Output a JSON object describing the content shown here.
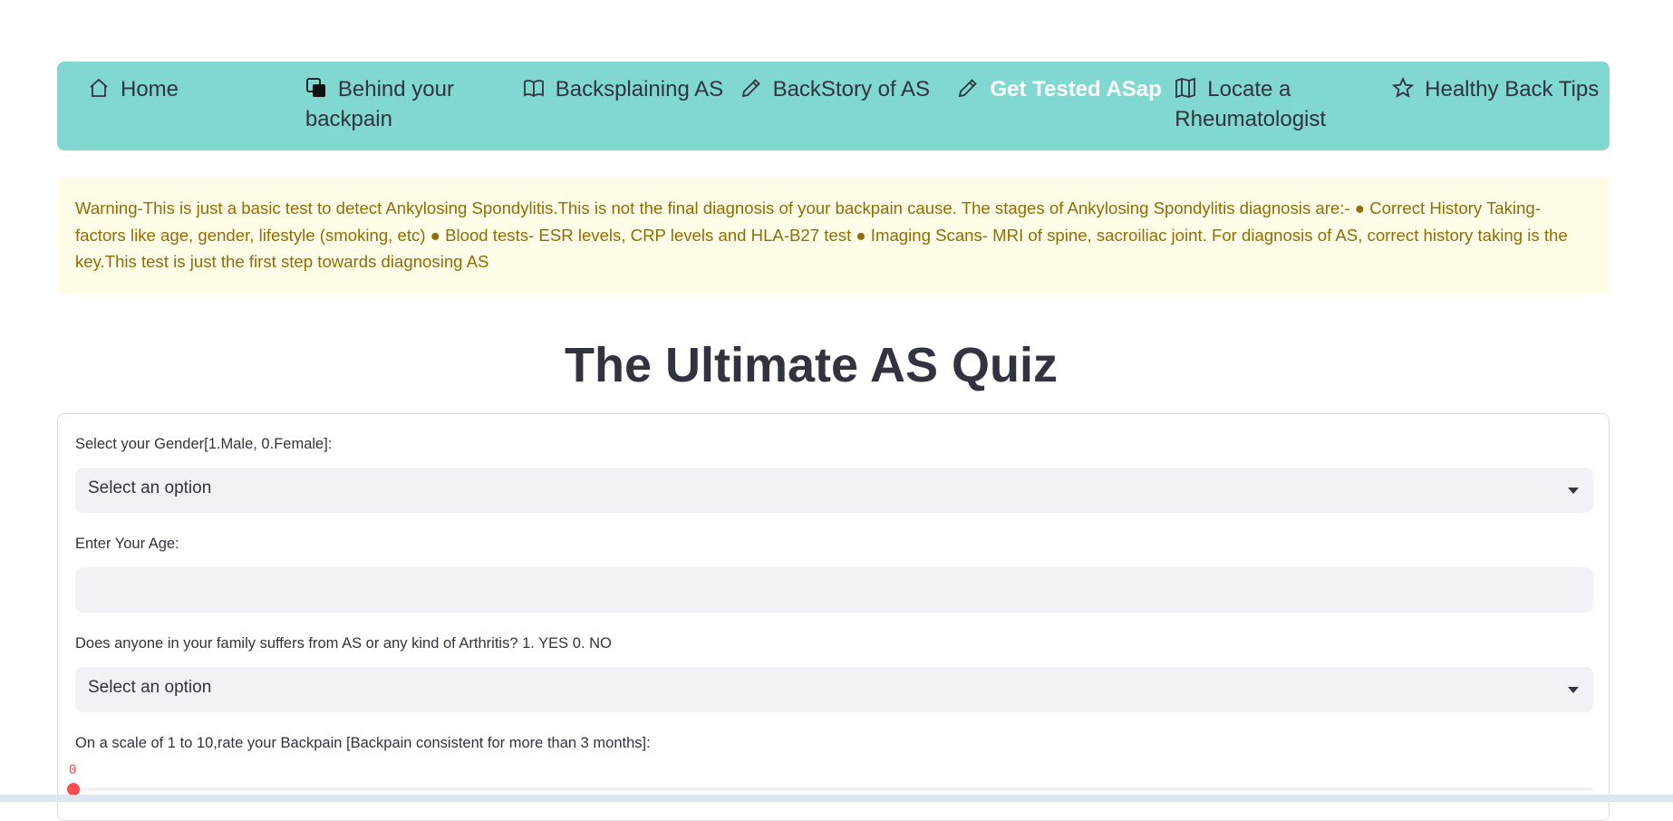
{
  "nav": {
    "items": [
      {
        "label": "Home",
        "icon": "house-icon"
      },
      {
        "label": "Behind your backpain",
        "icon": "layered-squares-icon"
      },
      {
        "label": "Backsplaining AS",
        "icon": "book-icon"
      },
      {
        "label": "BackStory of AS",
        "icon": "pencil-icon"
      },
      {
        "label": "Get Tested ASap",
        "icon": "pencil-icon",
        "active": true
      },
      {
        "label": "Locate a Rheumatologist",
        "icon": "map-icon"
      },
      {
        "label": "Healthy Back Tips",
        "icon": "star-icon"
      }
    ],
    "background": "#80d8d0"
  },
  "warning": {
    "text": "Warning-This is just a basic test to detect Ankylosing Spondylitis.This is not the final diagnosis of your backpain cause. The stages of Ankylosing Spondylitis diagnosis are:- ● Correct History Taking- factors like age, gender, lifestyle (smoking, etc) ● Blood tests- ESR levels, CRP levels and HLA-B27 test ● Imaging Scans- MRI of spine, sacroiliac joint. For diagnosis of AS, correct history taking is the key.This test is just the first step towards diagnosing AS"
  },
  "quiz": {
    "title": "The Ultimate AS Quiz",
    "gender": {
      "label": "Select your Gender[1.Male, 0.Female]:",
      "value": "Select an option"
    },
    "age": {
      "label": "Enter Your Age:",
      "value": ""
    },
    "family": {
      "label": "Does anyone in your family suffers from AS or any kind of Arthritis? 1. YES 0. NO",
      "value": "Select an option"
    },
    "backpain": {
      "label": "On a scale of 1 to 10,rate your Backpain [Backpain consistent for more than 3 months]:",
      "value": "0"
    }
  }
}
